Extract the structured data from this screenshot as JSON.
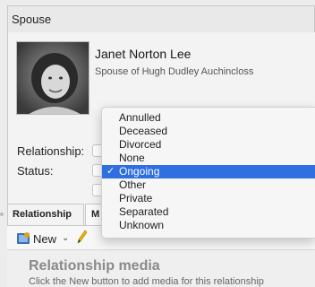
{
  "panel": {
    "title": "Spouse"
  },
  "person": {
    "name": "Janet Norton Lee",
    "relation_text": "Spouse of Hugh Dudley Auchincloss"
  },
  "fields": {
    "relationship_label": "Relationship:",
    "status_label": "Status:"
  },
  "tabs": {
    "active_label": "Relationship",
    "second_label": "M"
  },
  "toolbar": {
    "new_label": "New"
  },
  "media": {
    "title": "Relationship media",
    "hint": "Click the New button to add media for this relationship"
  },
  "status_dropdown": {
    "options": [
      "Annulled",
      "Deceased",
      "Divorced",
      "None",
      "Ongoing",
      "Other",
      "Private",
      "Separated",
      "Unknown"
    ],
    "selected": "Ongoing",
    "check_mark": "✓"
  },
  "colors": {
    "selection": "#2f6fe0",
    "panel_bg": "#f3f3f3"
  }
}
